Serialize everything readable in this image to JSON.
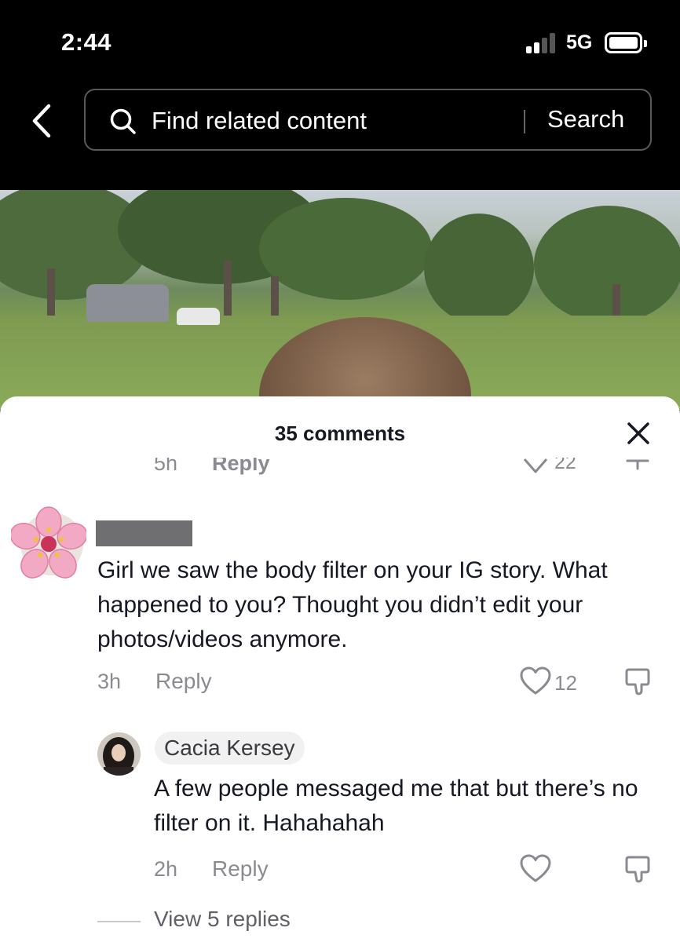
{
  "status_bar": {
    "time": "2:44",
    "network": "5G",
    "signal_bars_filled": 2,
    "signal_bars_total": 4
  },
  "header": {
    "back_icon": "chevron-left-icon",
    "search": {
      "placeholder": "Find related content",
      "icon": "search-icon",
      "button_label": "Search"
    }
  },
  "comments_sheet": {
    "title": "35 comments",
    "close_icon": "close-icon",
    "cutoff_row": {
      "time": "5h",
      "reply_label": "Reply",
      "likes": "22"
    },
    "comments": [
      {
        "author": "",
        "author_redacted": true,
        "avatar": "pink-flower-avatar",
        "text": "Girl we saw the body filter on your IG story. What happened to you? Thought you didn’t edit your photos/videos anymore.",
        "time": "3h",
        "reply_label": "Reply",
        "likes": "12"
      }
    ],
    "replies": [
      {
        "author": "Cacia Kersey",
        "avatar": "profile-photo-avatar",
        "text": "A few people messaged me that but there’s no filter on it. Hahahahah",
        "time": "2h",
        "reply_label": "Reply",
        "likes": ""
      }
    ],
    "view_replies_label": "View 5 replies"
  }
}
